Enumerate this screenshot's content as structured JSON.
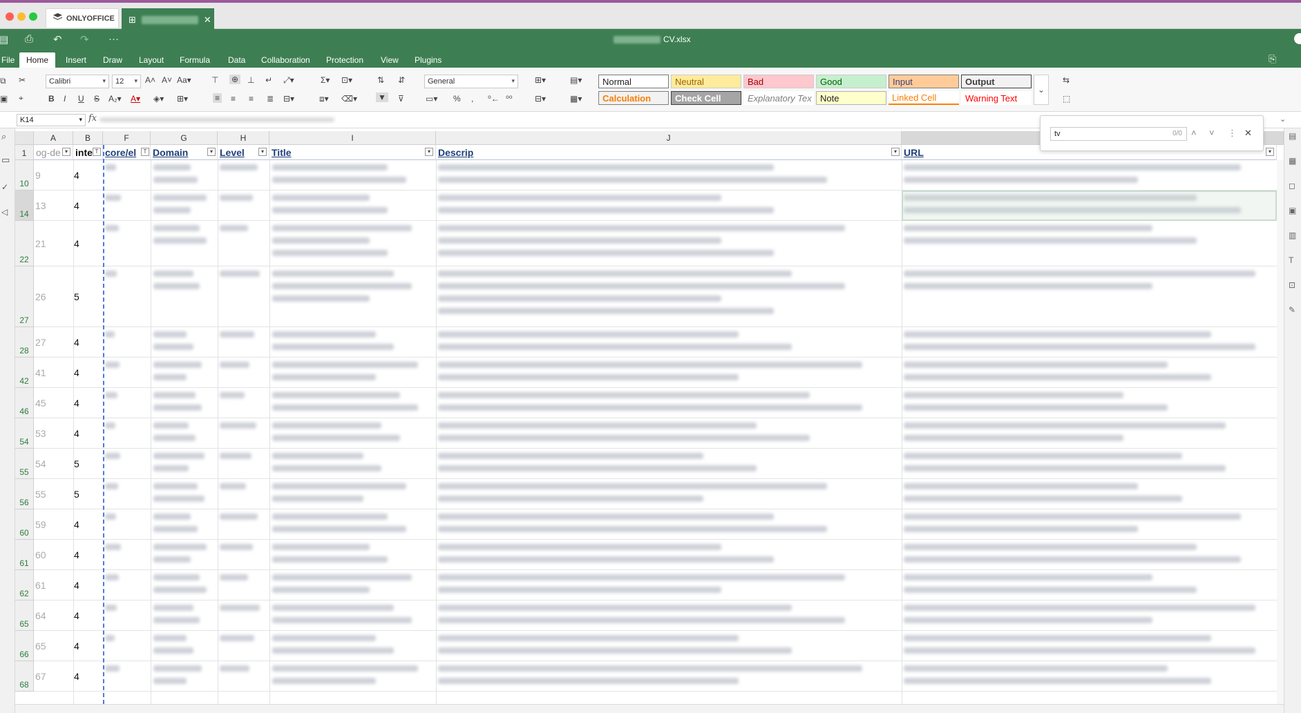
{
  "app": {
    "tab_app_label": "ONLYOFFICE",
    "file_name": "CV.xlsx"
  },
  "menu": {
    "tabs": [
      "File",
      "Home",
      "Insert",
      "Draw",
      "Layout",
      "Formula",
      "Data",
      "Collaboration",
      "Protection",
      "View",
      "Plugins"
    ],
    "active": "Home"
  },
  "ribbon": {
    "font_name": "Calibri",
    "font_size": "12",
    "number_format": "General",
    "cell_styles": [
      {
        "label": "Normal",
        "bg": "#ffffff",
        "fg": "#222222",
        "border": "#777777"
      },
      {
        "label": "Neutral",
        "bg": "#ffeb9c",
        "fg": "#9c6500",
        "border": "#cccccc"
      },
      {
        "label": "Bad",
        "bg": "#ffc7ce",
        "fg": "#9c0006",
        "border": "#cccccc"
      },
      {
        "label": "Good",
        "bg": "#c6efce",
        "fg": "#006100",
        "border": "#cccccc"
      },
      {
        "label": "Input",
        "bg": "#ffcc99",
        "fg": "#3f3f76",
        "border": "#7f7f7f"
      },
      {
        "label": "Output",
        "bg": "#f2f2f2",
        "fg": "#3f3f3f",
        "border": "#3f3f3f"
      },
      {
        "label": "Calculation",
        "bg": "#f2f2f2",
        "fg": "#fa7d00",
        "border": "#7f7f7f"
      },
      {
        "label": "Check Cell",
        "bg": "#a5a5a5",
        "fg": "#ffffff",
        "border": "#3f3f3f"
      },
      {
        "label": "Explanatory Tex",
        "bg": "#ffffff",
        "fg": "#7f7f7f",
        "border": "#ffffff"
      },
      {
        "label": "Note",
        "bg": "#ffffcc",
        "fg": "#222222",
        "border": "#b2b2b2"
      },
      {
        "label": "Linked Cell",
        "bg": "#ffffff",
        "fg": "#fa7d00",
        "border": "#ff8001"
      },
      {
        "label": "Warning Text",
        "bg": "#ffffff",
        "fg": "#ff0000",
        "border": "#ffffff"
      }
    ]
  },
  "formula_bar": {
    "cell_ref": "K14",
    "fx_label": "fx"
  },
  "find": {
    "query": "tv",
    "count": "0/0"
  },
  "sheet": {
    "columns": [
      {
        "letter": "A",
        "header": "og-de"
      },
      {
        "letter": "B",
        "header": "inte"
      },
      {
        "letter": "F",
        "header": "core/el"
      },
      {
        "letter": "G",
        "header": "Domain"
      },
      {
        "letter": "H",
        "header": "Level"
      },
      {
        "letter": "I",
        "header": "Title"
      },
      {
        "letter": "J",
        "header": "Descrip"
      },
      {
        "letter": "K",
        "header": "URL"
      }
    ],
    "header_row_number": "1",
    "rows": [
      {
        "num": "10",
        "a": "9",
        "b": "4"
      },
      {
        "num": "14",
        "a": "13",
        "b": "4"
      },
      {
        "num": "22",
        "a": "21",
        "b": "4"
      },
      {
        "num": "27",
        "a": "26",
        "b": "5"
      },
      {
        "num": "28",
        "a": "27",
        "b": "4"
      },
      {
        "num": "42",
        "a": "41",
        "b": "4"
      },
      {
        "num": "46",
        "a": "45",
        "b": "4"
      },
      {
        "num": "54",
        "a": "53",
        "b": "4"
      },
      {
        "num": "55",
        "a": "54",
        "b": "5"
      },
      {
        "num": "56",
        "a": "55",
        "b": "5"
      },
      {
        "num": "60",
        "a": "59",
        "b": "4"
      },
      {
        "num": "61",
        "a": "60",
        "b": "4"
      },
      {
        "num": "62",
        "a": "61",
        "b": "4"
      },
      {
        "num": "65",
        "a": "64",
        "b": "4"
      },
      {
        "num": "66",
        "a": "65",
        "b": "4"
      },
      {
        "num": "68",
        "a": "67",
        "b": "4"
      }
    ]
  },
  "colors": {
    "brand_green": "#3d7f52",
    "row_number_green": "#2e7d3e",
    "header_blue": "#1f3f7a"
  }
}
